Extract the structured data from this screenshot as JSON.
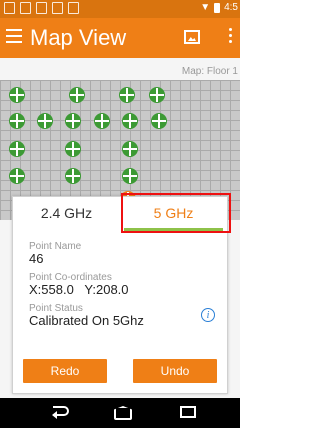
{
  "status_bar": {
    "time": "4:5"
  },
  "app_bar": {
    "title": "Map View"
  },
  "map": {
    "floor_label": "Map: Floor 1"
  },
  "panel": {
    "tabs": [
      {
        "label": "2.4 GHz"
      },
      {
        "label": "5 GHz"
      }
    ],
    "point_name_label": "Point Name",
    "point_name": "46",
    "coords_label": "Point Co-ordinates",
    "coords_value": "X:558.0   Y:208.0",
    "status_label": "Point Status",
    "status_value": "Calibrated On 5Ghz",
    "info_icon": "i",
    "redo_label": "Redo",
    "undo_label": "Undo"
  },
  "colors": {
    "accent": "#ef7f16",
    "point": "#3c9a34",
    "tab_indicator": "#8ec24a",
    "highlight": "#e11111"
  }
}
